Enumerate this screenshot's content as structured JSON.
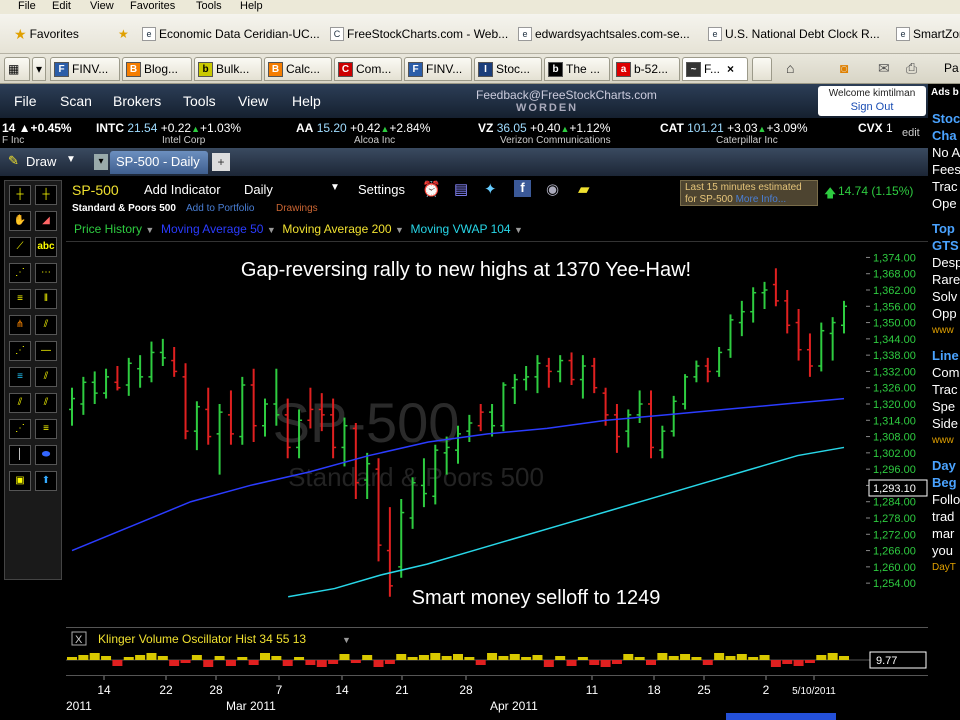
{
  "browser": {
    "menu": [
      "File",
      "Edit",
      "View",
      "Favorites",
      "Tools",
      "Help"
    ],
    "favorites_label": "Favorites",
    "favorites": [
      "Economic Data Ceridian-UC...",
      "FreeStockCharts.com - Web...",
      "edwardsyachtsales.com-se...",
      "U.S. National Debt Clock R...",
      "SmartZon"
    ],
    "tabs": [
      "FINV...",
      "Blog...",
      "Bulk...",
      "Calc...",
      "Com...",
      "FINV...",
      "Stoc...",
      "The ...",
      "b-52...",
      "F..."
    ],
    "tab_close": "×",
    "toolbar_cut": "Pa"
  },
  "app": {
    "menu": [
      "File",
      "Scan",
      "Brokers",
      "Tools",
      "View",
      "Help"
    ],
    "feedback": "Feedback@FreeStockCharts.com",
    "brand": "WORDEN",
    "welcome": "Welcome kimtilman",
    "sign_out": "Sign Out",
    "ads_label": "Ads b"
  },
  "ticker": {
    "lead": "14 ▲+0.45%",
    "lead_sub": "F Inc",
    "items": [
      {
        "sym": "INTC",
        "price": "21.54",
        "chg": "+0.22",
        "pct": "+1.03%",
        "name": "Intel Corp"
      },
      {
        "sym": "AA",
        "price": "15.20",
        "chg": "+0.42",
        "pct": "+2.84%",
        "name": "Alcoa Inc"
      },
      {
        "sym": "VZ",
        "price": "36.05",
        "chg": "+0.40",
        "pct": "+1.12%",
        "name": "Verizon Communications"
      },
      {
        "sym": "CAT",
        "price": "101.21",
        "chg": "+3.03",
        "pct": "+3.09%",
        "name": "Caterpillar Inc"
      },
      {
        "sym": "CVX",
        "price": "1",
        "chg": "",
        "pct": "",
        "name": ""
      }
    ],
    "edit": "edit"
  },
  "drawbar": {
    "draw": "Draw",
    "tab": "SP-500 - Daily"
  },
  "chart_head": {
    "symbol": "SP-500",
    "add_indicator": "Add Indicator",
    "period": "Daily",
    "settings": "Settings",
    "name": "Standard & Poors 500",
    "add_portfolio": "Add to Portfolio",
    "drawings": "Drawings",
    "delay_line1": "Last 15 minutes estimated",
    "delay_line2": "for SP-500",
    "more_info": "More Info...",
    "change": "14.74 (1.15%)",
    "legend": [
      {
        "label": "Price History",
        "color": "#2ecc40"
      },
      {
        "label": "Moving Average 50",
        "color": "#2b3cff"
      },
      {
        "label": "Moving Average 200",
        "color": "#f0e130"
      },
      {
        "label": "Moving VWAP 104",
        "color": "#28d7e8"
      }
    ]
  },
  "chart_data": {
    "type": "bar",
    "title": "",
    "watermark": "SP-500",
    "watermark_sub": "Standard & Poors 500",
    "annotations": [
      "Gap-reversing rally to new highs at 1370 Yee-Haw!",
      "Smart money selloff to 1249"
    ],
    "y_ticks": [
      "1,374.00",
      "1,368.00",
      "1,362.00",
      "1,356.00",
      "1,350.00",
      "1,344.00",
      "1,338.00",
      "1,332.00",
      "1,326.00",
      "1,320.00",
      "1,314.00",
      "1,308.00",
      "1,302.00",
      "1,296.00",
      "1,290.00",
      "1,284.00",
      "1,278.00",
      "1,272.00",
      "1,266.00",
      "1,260.00",
      "1,254.00"
    ],
    "ylim": [
      1250,
      1376
    ],
    "last_price": "1,293.10",
    "x_ticks": [
      "14",
      "22",
      "28",
      "7",
      "14",
      "21",
      "28",
      "11",
      "18",
      "25",
      "2",
      "5/10/2011"
    ],
    "x_months": [
      "2011",
      "Mar 2011",
      "Apr 2011"
    ],
    "bars": [
      {
        "o": 1318,
        "h": 1326,
        "l": 1312,
        "c": 1322,
        "d": "up"
      },
      {
        "o": 1320,
        "h": 1330,
        "l": 1316,
        "c": 1328,
        "d": "up"
      },
      {
        "o": 1328,
        "h": 1332,
        "l": 1320,
        "c": 1324,
        "d": "up"
      },
      {
        "o": 1324,
        "h": 1333,
        "l": 1322,
        "c": 1330,
        "d": "up"
      },
      {
        "o": 1328,
        "h": 1334,
        "l": 1325,
        "c": 1326,
        "d": "dn"
      },
      {
        "o": 1327,
        "h": 1337,
        "l": 1323,
        "c": 1335,
        "d": "up"
      },
      {
        "o": 1333,
        "h": 1338,
        "l": 1326,
        "c": 1330,
        "d": "up"
      },
      {
        "o": 1330,
        "h": 1343,
        "l": 1328,
        "c": 1339,
        "d": "up"
      },
      {
        "o": 1339,
        "h": 1344,
        "l": 1334,
        "c": 1337,
        "d": "up"
      },
      {
        "o": 1336,
        "h": 1341,
        "l": 1330,
        "c": 1332,
        "d": "dn"
      },
      {
        "o": 1330,
        "h": 1335,
        "l": 1307,
        "c": 1310,
        "d": "dn"
      },
      {
        "o": 1310,
        "h": 1321,
        "l": 1303,
        "c": 1319,
        "d": "up"
      },
      {
        "o": 1318,
        "h": 1326,
        "l": 1305,
        "c": 1308,
        "d": "dn"
      },
      {
        "o": 1309,
        "h": 1320,
        "l": 1294,
        "c": 1317,
        "d": "up"
      },
      {
        "o": 1316,
        "h": 1325,
        "l": 1305,
        "c": 1309,
        "d": "dn"
      },
      {
        "o": 1308,
        "h": 1330,
        "l": 1305,
        "c": 1327,
        "d": "up"
      },
      {
        "o": 1327,
        "h": 1333,
        "l": 1306,
        "c": 1312,
        "d": "dn"
      },
      {
        "o": 1312,
        "h": 1322,
        "l": 1308,
        "c": 1320,
        "d": "up"
      },
      {
        "o": 1320,
        "h": 1333,
        "l": 1312,
        "c": 1316,
        "d": "up"
      },
      {
        "o": 1316,
        "h": 1322,
        "l": 1300,
        "c": 1304,
        "d": "dn"
      },
      {
        "o": 1304,
        "h": 1318,
        "l": 1300,
        "c": 1314,
        "d": "up"
      },
      {
        "o": 1314,
        "h": 1326,
        "l": 1311,
        "c": 1318,
        "d": "dn"
      },
      {
        "o": 1318,
        "h": 1324,
        "l": 1310,
        "c": 1316,
        "d": "dn"
      },
      {
        "o": 1316,
        "h": 1322,
        "l": 1300,
        "c": 1304,
        "d": "dn"
      },
      {
        "o": 1304,
        "h": 1315,
        "l": 1297,
        "c": 1312,
        "d": "up"
      },
      {
        "o": 1311,
        "h": 1313,
        "l": 1285,
        "c": 1291,
        "d": "dn"
      },
      {
        "o": 1292,
        "h": 1302,
        "l": 1285,
        "c": 1298,
        "d": "up"
      },
      {
        "o": 1296,
        "h": 1300,
        "l": 1262,
        "c": 1268,
        "d": "dn"
      },
      {
        "o": 1266,
        "h": 1282,
        "l": 1249,
        "c": 1253,
        "d": "dn"
      },
      {
        "o": 1260,
        "h": 1285,
        "l": 1256,
        "c": 1280,
        "d": "up"
      },
      {
        "o": 1278,
        "h": 1293,
        "l": 1274,
        "c": 1291,
        "d": "up"
      },
      {
        "o": 1290,
        "h": 1300,
        "l": 1282,
        "c": 1287,
        "d": "up"
      },
      {
        "o": 1286,
        "h": 1305,
        "l": 1283,
        "c": 1303,
        "d": "up"
      },
      {
        "o": 1302,
        "h": 1308,
        "l": 1294,
        "c": 1304,
        "d": "up"
      },
      {
        "o": 1303,
        "h": 1312,
        "l": 1298,
        "c": 1309,
        "d": "up"
      },
      {
        "o": 1310,
        "h": 1316,
        "l": 1306,
        "c": 1313,
        "d": "up"
      },
      {
        "o": 1312,
        "h": 1320,
        "l": 1310,
        "c": 1317,
        "d": "dn"
      },
      {
        "o": 1317,
        "h": 1320,
        "l": 1308,
        "c": 1312,
        "d": "up"
      },
      {
        "o": 1312,
        "h": 1328,
        "l": 1310,
        "c": 1327,
        "d": "up"
      },
      {
        "o": 1326,
        "h": 1331,
        "l": 1320,
        "c": 1329,
        "d": "up"
      },
      {
        "o": 1329,
        "h": 1334,
        "l": 1325,
        "c": 1330,
        "d": "up"
      },
      {
        "o": 1330,
        "h": 1338,
        "l": 1324,
        "c": 1335,
        "d": "up"
      },
      {
        "o": 1334,
        "h": 1337,
        "l": 1326,
        "c": 1332,
        "d": "dn"
      },
      {
        "o": 1332,
        "h": 1338,
        "l": 1328,
        "c": 1336,
        "d": "up"
      },
      {
        "o": 1336,
        "h": 1339,
        "l": 1327,
        "c": 1329,
        "d": "dn"
      },
      {
        "o": 1329,
        "h": 1338,
        "l": 1322,
        "c": 1334,
        "d": "up"
      },
      {
        "o": 1334,
        "h": 1337,
        "l": 1324,
        "c": 1326,
        "d": "dn"
      },
      {
        "o": 1324,
        "h": 1326,
        "l": 1312,
        "c": 1316,
        "d": "dn"
      },
      {
        "o": 1316,
        "h": 1320,
        "l": 1302,
        "c": 1308,
        "d": "dn"
      },
      {
        "o": 1310,
        "h": 1318,
        "l": 1304,
        "c": 1316,
        "d": "up"
      },
      {
        "o": 1316,
        "h": 1325,
        "l": 1313,
        "c": 1320,
        "d": "up"
      },
      {
        "o": 1320,
        "h": 1325,
        "l": 1300,
        "c": 1304,
        "d": "dn"
      },
      {
        "o": 1303,
        "h": 1312,
        "l": 1300,
        "c": 1310,
        "d": "up"
      },
      {
        "o": 1310,
        "h": 1323,
        "l": 1308,
        "c": 1321,
        "d": "up"
      },
      {
        "o": 1320,
        "h": 1331,
        "l": 1318,
        "c": 1330,
        "d": "up"
      },
      {
        "o": 1330,
        "h": 1336,
        "l": 1328,
        "c": 1334,
        "d": "up"
      },
      {
        "o": 1334,
        "h": 1337,
        "l": 1328,
        "c": 1332,
        "d": "dn"
      },
      {
        "o": 1332,
        "h": 1341,
        "l": 1330,
        "c": 1339,
        "d": "up"
      },
      {
        "o": 1340,
        "h": 1353,
        "l": 1337,
        "c": 1351,
        "d": "up"
      },
      {
        "o": 1350,
        "h": 1358,
        "l": 1345,
        "c": 1354,
        "d": "up"
      },
      {
        "o": 1354,
        "h": 1363,
        "l": 1350,
        "c": 1361,
        "d": "up"
      },
      {
        "o": 1361,
        "h": 1365,
        "l": 1355,
        "c": 1362,
        "d": "up"
      },
      {
        "o": 1364,
        "h": 1370,
        "l": 1356,
        "c": 1358,
        "d": "dn"
      },
      {
        "o": 1358,
        "h": 1362,
        "l": 1346,
        "c": 1349,
        "d": "dn"
      },
      {
        "o": 1350,
        "h": 1355,
        "l": 1336,
        "c": 1340,
        "d": "dn"
      },
      {
        "o": 1340,
        "h": 1346,
        "l": 1330,
        "c": 1334,
        "d": "dn"
      },
      {
        "o": 1334,
        "h": 1350,
        "l": 1332,
        "c": 1347,
        "d": "up"
      },
      {
        "o": 1346,
        "h": 1352,
        "l": 1336,
        "c": 1350,
        "d": "up"
      },
      {
        "o": 1349,
        "h": 1358,
        "l": 1346,
        "c": 1356,
        "d": "up"
      }
    ],
    "ma50": [
      1266,
      1275,
      1284,
      1290,
      1295,
      1301,
      1306,
      1309,
      1311,
      1314,
      1316,
      1318,
      1320,
      1322
    ],
    "vwap104": [
      1249,
      1252,
      1257,
      1261,
      1266,
      1271,
      1276,
      1281,
      1286,
      1291,
      1296,
      1301,
      1304
    ],
    "klinger": {
      "label": "Klinger Volume Oscillator Hist 34 55 13",
      "value": "9.77"
    }
  },
  "side": {
    "lines": [
      {
        "t": "Stoc",
        "c": "lnk"
      },
      {
        "t": "Cha",
        "c": "lnk"
      },
      {
        "t": "No A",
        "c": ""
      },
      {
        "t": "Fees",
        "c": ""
      },
      {
        "t": "Trac",
        "c": ""
      },
      {
        "t": "Ope",
        "c": ""
      },
      {
        "t": "Top",
        "c": "lnk"
      },
      {
        "t": "GTS",
        "c": "lnk"
      },
      {
        "t": "Desp",
        "c": ""
      },
      {
        "t": "Rare",
        "c": ""
      },
      {
        "t": "Solv",
        "c": ""
      },
      {
        "t": "Opp",
        "c": ""
      },
      {
        "t": "www",
        "c": "sm"
      },
      {
        "t": "Line",
        "c": "lnk"
      },
      {
        "t": "Com",
        "c": ""
      },
      {
        "t": "Trac",
        "c": ""
      },
      {
        "t": "Spe",
        "c": ""
      },
      {
        "t": "Side",
        "c": ""
      },
      {
        "t": "www",
        "c": "sm"
      },
      {
        "t": "Day",
        "c": "lnk"
      },
      {
        "t": "Beg",
        "c": "lnk"
      },
      {
        "t": "Follo",
        "c": ""
      },
      {
        "t": "trad",
        "c": ""
      },
      {
        "t": "mar",
        "c": ""
      },
      {
        "t": "you",
        "c": ""
      },
      {
        "t": "DayT",
        "c": "sm"
      }
    ]
  }
}
